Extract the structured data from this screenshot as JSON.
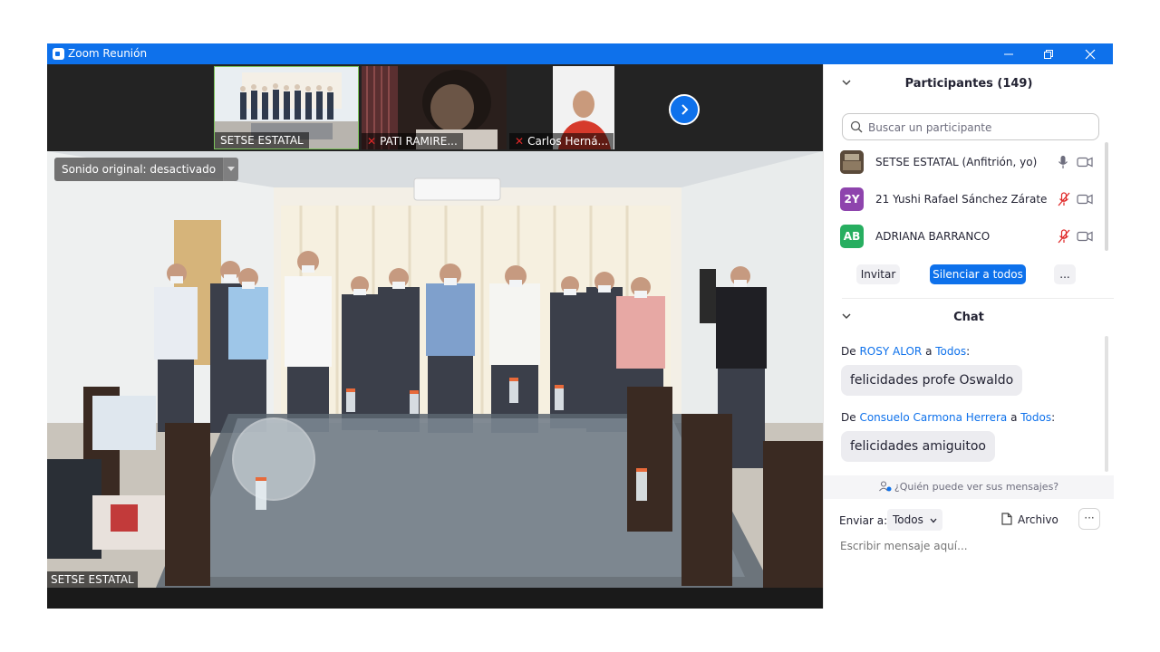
{
  "window": {
    "title": "Zoom Reunión",
    "titlebar_color": "#0e71eb"
  },
  "video": {
    "thumbnails": [
      {
        "label": "SETSE ESTATAL",
        "muted": false,
        "active": true
      },
      {
        "label": "PATI RAMIRE...",
        "muted": true,
        "active": false
      },
      {
        "label": "Carlos Herná...",
        "muted": true,
        "active": false
      }
    ],
    "sound_toggle": "Sonido original: desactivado",
    "main_speaker_label": "SETSE ESTATAL"
  },
  "participants": {
    "header": "Participantes (149)",
    "search_placeholder": "Buscar un participante",
    "list": [
      {
        "initials": "",
        "avatar_color": "#6b5a44",
        "name": "SETSE ESTATAL (Anfitrión, yo)",
        "muted": false
      },
      {
        "initials": "2Y",
        "avatar_color": "#8e44ad",
        "name": "21 Yushi Rafael Sánchez Zárate",
        "muted": true
      },
      {
        "initials": "AB",
        "avatar_color": "#27ae60",
        "name": "ADRIANA BARRANCO",
        "muted": true
      }
    ],
    "invite_label": "Invitar",
    "mute_all_label": "Silenciar a todos",
    "more_label": "..."
  },
  "chat": {
    "header": "Chat",
    "messages": [
      {
        "from_prefix": "De",
        "sender": "ROSY ALOR",
        "to_word": "a",
        "recipient": "Todos",
        "text": "felicidades profe Oswaldo"
      },
      {
        "from_prefix": "De",
        "sender": "Consuelo Carmona Herrera",
        "to_word": "a",
        "recipient": "Todos",
        "text": "felicidades amiguitoo"
      }
    ],
    "who_sees": "¿Quién puede ver sus mensajes?",
    "send_to_label": "Enviar a:",
    "send_to_value": "Todos",
    "file_label": "Archivo",
    "more_label": "···",
    "input_placeholder": "Escribir mensaje aquí..."
  }
}
